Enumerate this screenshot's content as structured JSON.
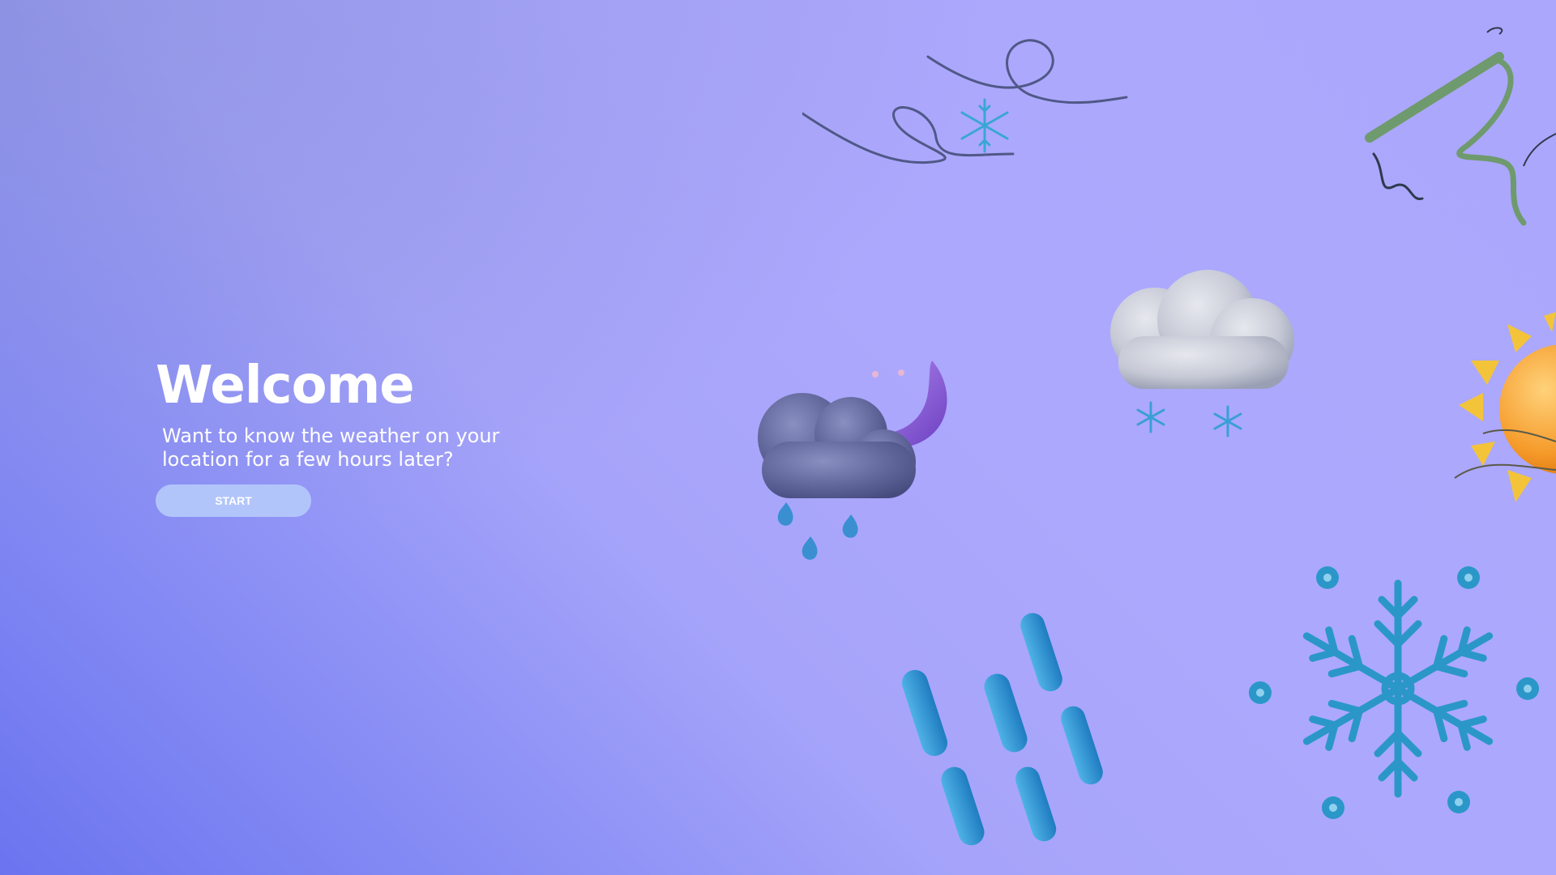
{
  "welcome": {
    "title": "Welcome",
    "subtitle": "Want to know the weather on your location for a few hours later?",
    "start_label": "START"
  },
  "colors": {
    "background_start": "#6b74ef",
    "background_end": "#aca8fd",
    "button": "#b2c5fb",
    "text": "#ffffff"
  },
  "illustrations": [
    "wind-swirl-icon",
    "snowflake-icon",
    "green-wind-icon",
    "snow-cloud-icon",
    "sun-icon",
    "night-rain-cloud-icon",
    "rain-drops-icon",
    "large-snowflake-icon"
  ]
}
